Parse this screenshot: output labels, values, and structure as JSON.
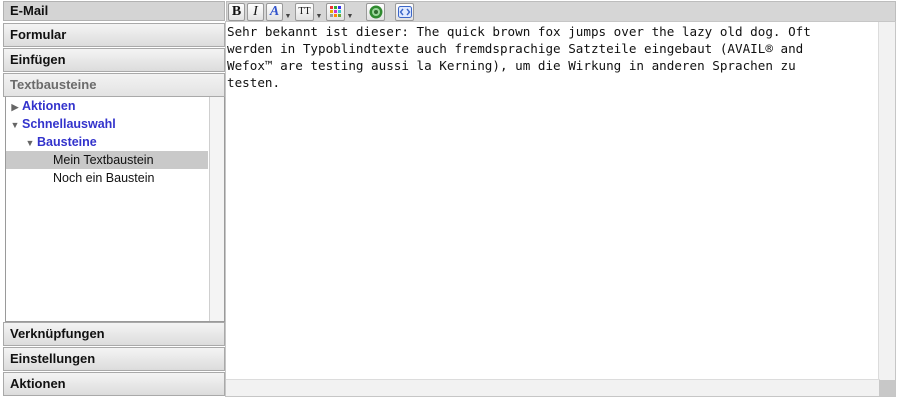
{
  "sidebar": {
    "sections": {
      "email": "E-Mail",
      "formular": "Formular",
      "einfuegen": "Einfügen",
      "textbausteine": "Textbausteine",
      "verknuepfungen": "Verknüpfungen",
      "einstellungen": "Einstellungen",
      "aktionen": "Aktionen"
    },
    "tree": {
      "aktionen": "Aktionen",
      "schnellauswahl": "Schnellauswahl",
      "bausteine": "Bausteine",
      "item1": "Mein Textbaustein",
      "item2": "Noch ein Baustein"
    }
  },
  "toolbar": {
    "bold": "B",
    "italic": "I",
    "font_color": "A",
    "font_size": "TT",
    "icons": [
      "palette-icon",
      "globe-icon",
      "source-code-icon"
    ]
  },
  "editor": {
    "text": "Sehr bekannt ist dieser: The quick brown fox jumps over the lazy old dog. Oft\nwerden in Typoblindtexte auch fremdsprachige Satzteile eingebaut (AVAIL® and\nWefox™ are testing aussi la Kerning), um die Wirkung in anderen Sprachen zu\ntesten."
  },
  "colors": {
    "link": "#3333cc",
    "selected_row": "#c9c9c9",
    "toolbar_bg": "#d6d6d6"
  }
}
